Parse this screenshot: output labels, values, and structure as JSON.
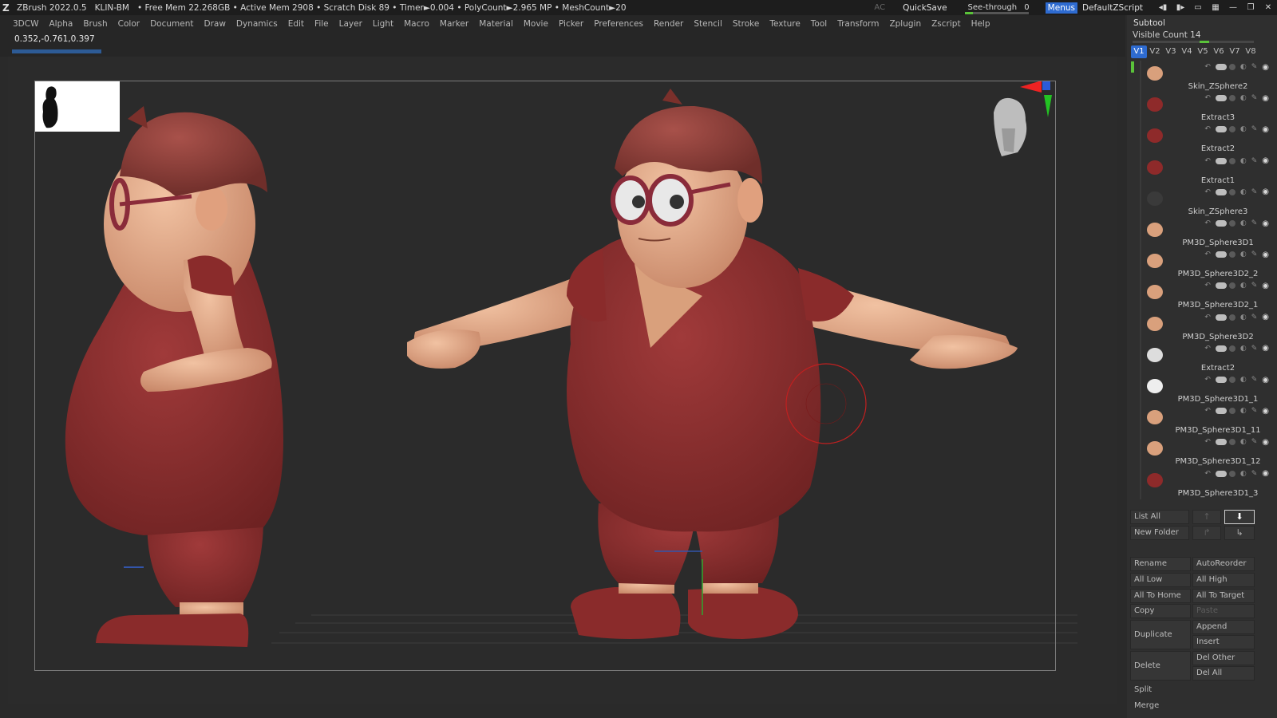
{
  "titlebar": {
    "app": "ZBrush 2022.0.5",
    "doc": "KLIN-BM",
    "stats": "• Free Mem 22.268GB • Active Mem 2908 • Scratch Disk 89 • Timer►0.004 • PolyCount►2.965 MP • MeshCount►20",
    "ac": "AC",
    "quicksave": "QuickSave",
    "see_through": "See-through",
    "see_through_value": "0",
    "menus": "Menus",
    "default_zscript": "DefaultZScript"
  },
  "menubar": {
    "items": [
      "3DCW",
      "Alpha",
      "Brush",
      "Color",
      "Document",
      "Draw",
      "Dynamics",
      "Edit",
      "File",
      "Layer",
      "Light",
      "Macro",
      "Marker",
      "Material",
      "Movie",
      "Picker",
      "Preferences",
      "Render",
      "Stencil",
      "Stroke",
      "Texture",
      "Tool",
      "Transform",
      "Zplugin",
      "Zscript",
      "Help"
    ]
  },
  "viewport": {
    "coordinates": "0.352,-0.761,0.397",
    "progress_fraction": 0.08
  },
  "subtool": {
    "title": "Subtool",
    "visible_count_label": "Visible Count 14",
    "tabs": [
      "V1",
      "V2",
      "V3",
      "V4",
      "V5",
      "V6",
      "V7",
      "V8"
    ],
    "active_tab": "V1",
    "items": [
      {
        "name": "Skin_ZSphere2",
        "selected": true,
        "thumb_color": "#d9a07c"
      },
      {
        "name": "Extract3",
        "selected": false,
        "thumb_color": "#8e2a2a"
      },
      {
        "name": "Extract2",
        "selected": false,
        "thumb_color": "#8e2a2a"
      },
      {
        "name": "Extract1",
        "selected": false,
        "thumb_color": "#8e2a2a"
      },
      {
        "name": "Skin_ZSphere3",
        "selected": false,
        "thumb_color": "#3a3a3a"
      },
      {
        "name": "PM3D_Sphere3D1",
        "selected": false,
        "thumb_color": "#d9a07c"
      },
      {
        "name": "PM3D_Sphere3D2_2",
        "selected": false,
        "thumb_color": "#d9a07c"
      },
      {
        "name": "PM3D_Sphere3D2_1",
        "selected": false,
        "thumb_color": "#d9a07c"
      },
      {
        "name": "PM3D_Sphere3D2",
        "selected": false,
        "thumb_color": "#d9a07c"
      },
      {
        "name": "Extract2",
        "selected": false,
        "thumb_color": "#dddddd"
      },
      {
        "name": "PM3D_Sphere3D1_1",
        "selected": false,
        "thumb_color": "#eeeeee"
      },
      {
        "name": "PM3D_Sphere3D1_11",
        "selected": false,
        "thumb_color": "#d9a07c"
      },
      {
        "name": "PM3D_Sphere3D1_12",
        "selected": false,
        "thumb_color": "#d9a07c"
      },
      {
        "name": "PM3D_Sphere3D1_3",
        "selected": false,
        "thumb_color": "#8e2a2a"
      }
    ],
    "buttons": {
      "list_all": "List All",
      "new_folder": "New Folder",
      "rename": "Rename",
      "auto_reorder": "AutoReorder",
      "all_low": "All Low",
      "all_high": "All High",
      "all_to_home": "All To Home",
      "all_to_target": "All To Target",
      "copy": "Copy",
      "paste": "Paste",
      "duplicate": "Duplicate",
      "append": "Append",
      "insert": "Insert",
      "delete": "Delete",
      "del_other": "Del Other",
      "del_all": "Del All",
      "split": "Split",
      "merge": "Merge"
    }
  },
  "colors": {
    "accent": "#2e6bd0",
    "active_green": "#5ac23a",
    "shirt": "#8e2a2a",
    "skin": "#e2a886"
  }
}
